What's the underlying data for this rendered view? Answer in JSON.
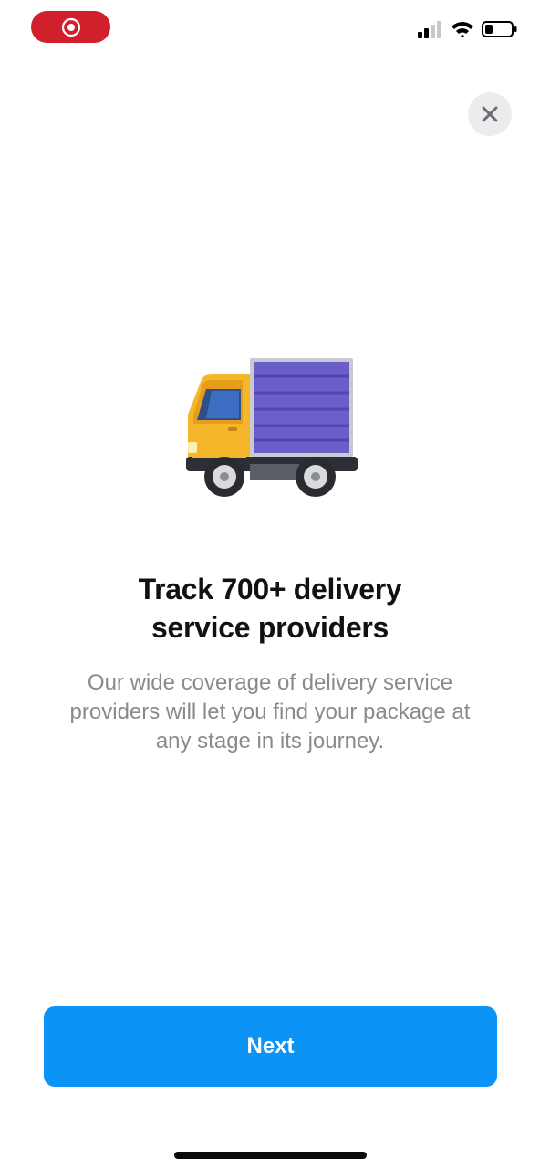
{
  "status_bar": {
    "record_icon": "screen-record-icon",
    "cellular_icon": "cellular-signal-icon",
    "wifi_icon": "wifi-icon",
    "battery_icon": "battery-icon",
    "record_color": "#d0202c"
  },
  "onboarding": {
    "close_icon": "close-icon",
    "illustration": "delivery-truck-icon",
    "title_line1": "Track 700+ delivery",
    "title_line2": "service providers",
    "body_line1": "Our wide coverage of delivery service",
    "body_line2": "providers will let you find your package at",
    "body_line3": "any stage in its journey.",
    "next_label": "Next",
    "accent_color": "#0b93f6"
  }
}
